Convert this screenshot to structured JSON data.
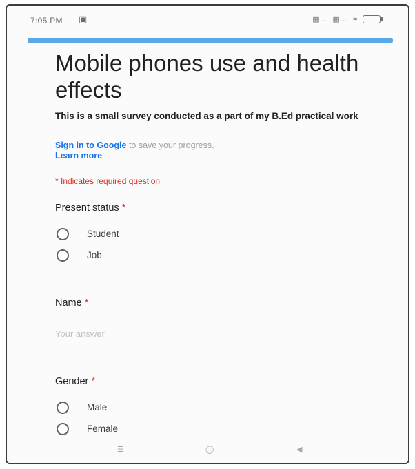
{
  "status_bar": {
    "time": "7:05 PM",
    "left_icon": "notification-icon",
    "right_icons": [
      "sim-signal-icon",
      "sim-signal-icon",
      "wifi-icon",
      "battery-icon"
    ]
  },
  "colors": {
    "accent": "#5aa9e6",
    "link": "#1a73e8",
    "required": "#d93025"
  },
  "form": {
    "title": "Mobile phones use and health effects",
    "description": "This is a small survey conducted as a part of my B.Ed practical work",
    "signin_link": "Sign in to Google",
    "signin_rest": " to save your progress.",
    "learn_more": "Learn more",
    "required_note": "* Indicates required question"
  },
  "questions": {
    "status": {
      "label": "Present status",
      "required": "*",
      "options": [
        "Student",
        "Job"
      ]
    },
    "name": {
      "label": "Name",
      "required": "*",
      "placeholder": "Your answer"
    },
    "gender": {
      "label": "Gender",
      "required": "*",
      "options": [
        "Male",
        "Female"
      ]
    }
  },
  "nav_bar": {
    "buttons": [
      "menu-icon",
      "home-icon",
      "back-icon"
    ]
  }
}
